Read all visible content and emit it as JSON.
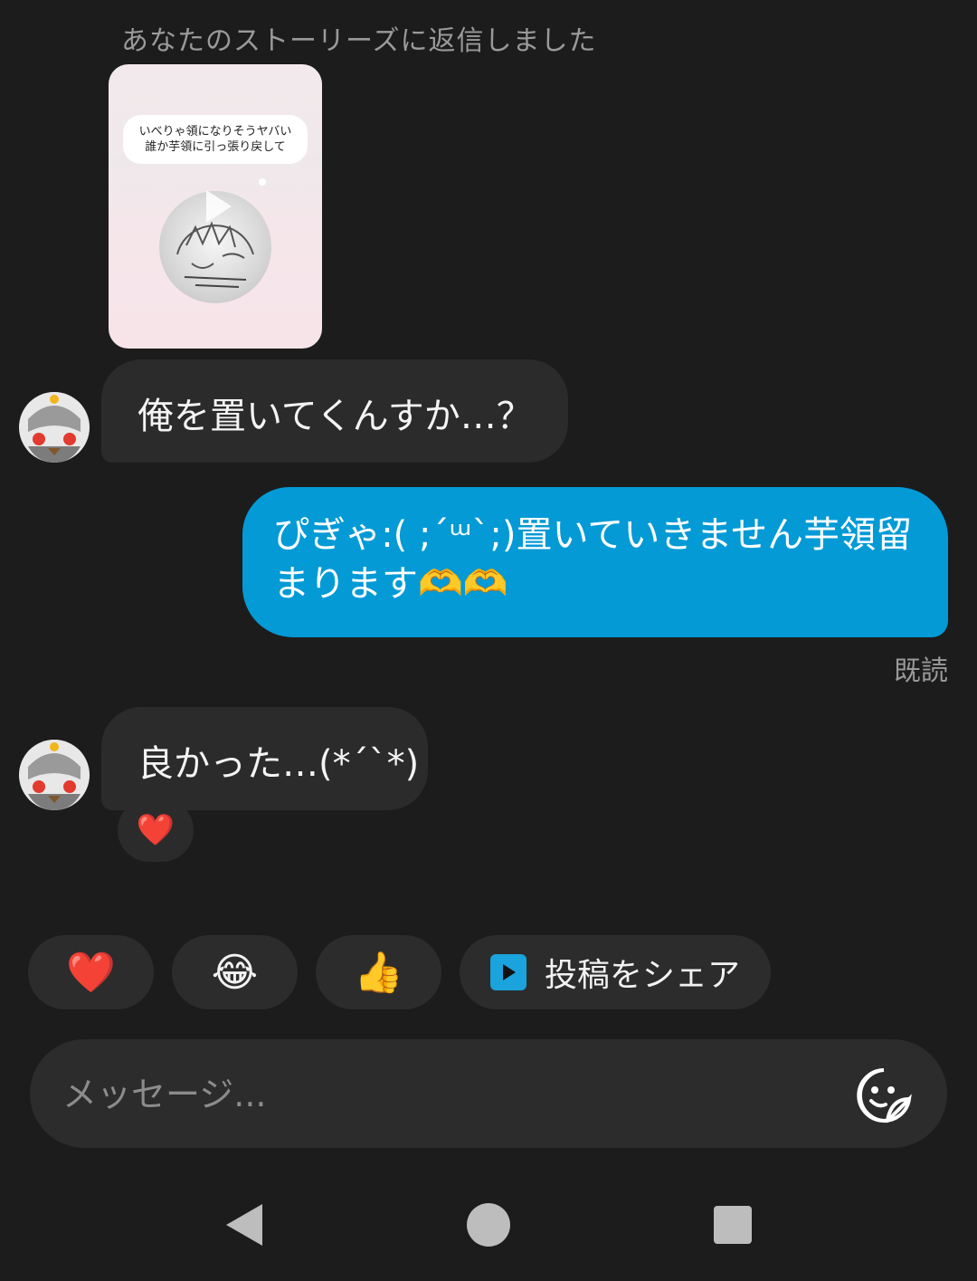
{
  "story_reply": {
    "caption": "あなたのストーリーズに返信しました",
    "story_text_line1": "いべりゃ領になりそうヤバい",
    "story_text_line2": "誰か芋領に引っ張り戻して"
  },
  "messages": [
    {
      "direction": "incoming",
      "text": "俺を置いてくんすか…？"
    },
    {
      "direction": "outgoing",
      "line1": "ぴぎゃ:( ;´ᵚ`;)置いていきません芋領留",
      "line2": "まります🫶🫶"
    },
    {
      "direction": "incoming",
      "text": "良かった…(*´`*)",
      "reaction": "❤️"
    }
  ],
  "read_receipt": "既読",
  "quick_reactions": [
    "❤️",
    "😂",
    "👍"
  ],
  "share_post_label": "投稿をシェア",
  "composer": {
    "placeholder": "メッセージ..."
  },
  "colors": {
    "background": "#1c1c1c",
    "incoming_bubble": "#2b2b2b",
    "outgoing_bubble": "#039ad6",
    "share_icon": "#1aa3dc"
  },
  "icons": {
    "sticker": "sticker-icon",
    "share": "share-post-icon",
    "nav_back": "back-triangle-icon",
    "nav_home": "home-circle-icon",
    "nav_recents": "recents-square-icon"
  }
}
